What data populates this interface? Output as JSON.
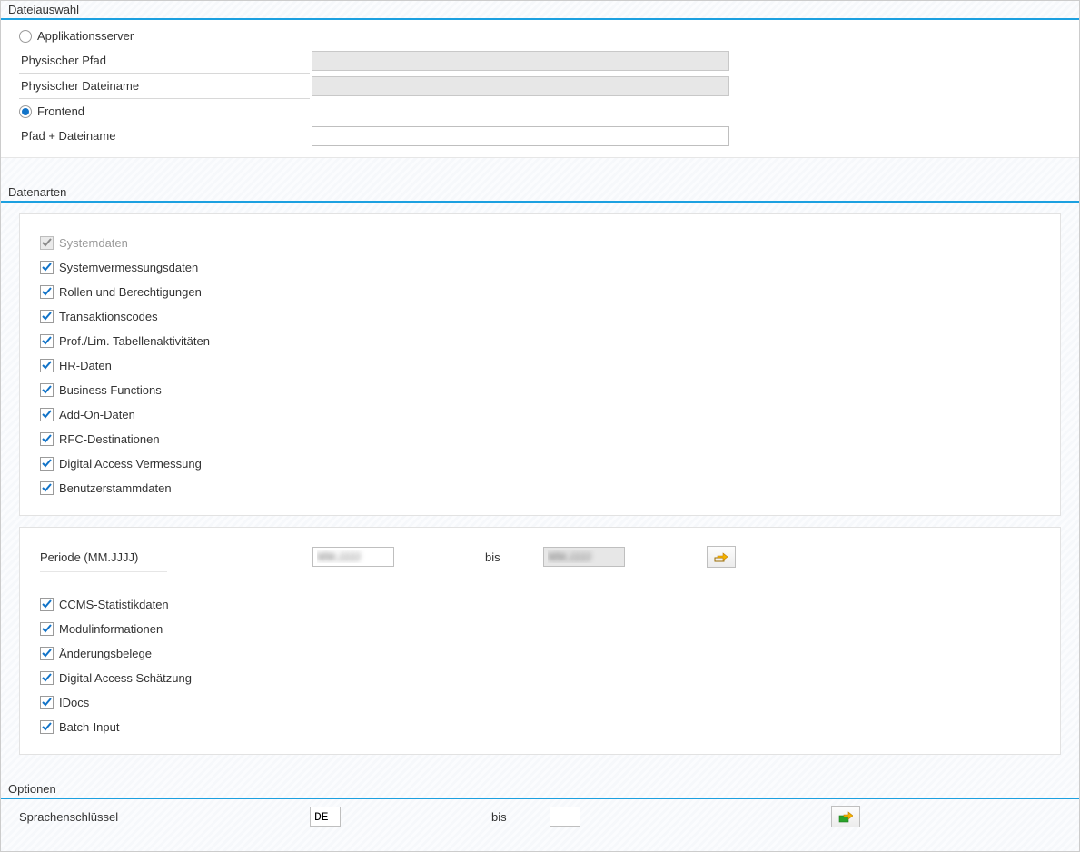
{
  "file_selection": {
    "title": "Dateiauswahl",
    "source_app_server": {
      "label": "Applikationsserver",
      "checked": false
    },
    "phys_path_label": "Physischer Pfad",
    "phys_path_value": "",
    "phys_file_label": "Physischer Dateiname",
    "phys_file_value": "",
    "source_frontend": {
      "label": "Frontend",
      "checked": true
    },
    "frontend_path_label": "Pfad + Dateiname",
    "frontend_path_value": ""
  },
  "data_types": {
    "title": "Datenarten",
    "group1": [
      {
        "key": "systemdaten",
        "label": "Systemdaten",
        "checked": true,
        "disabled": true
      },
      {
        "key": "sysvermessung",
        "label": "Systemvermessungsdaten",
        "checked": true,
        "disabled": false
      },
      {
        "key": "rollen",
        "label": "Rollen und Berechtigungen",
        "checked": true,
        "disabled": false
      },
      {
        "key": "tcodes",
        "label": "Transaktionscodes",
        "checked": true,
        "disabled": false
      },
      {
        "key": "proflim",
        "label": "Prof./Lim. Tabellenaktivitäten",
        "checked": true,
        "disabled": false
      },
      {
        "key": "hrdaten",
        "label": "HR-Daten",
        "checked": true,
        "disabled": false
      },
      {
        "key": "businessfunc",
        "label": "Business Functions",
        "checked": true,
        "disabled": false
      },
      {
        "key": "addon",
        "label": "Add-On-Daten",
        "checked": true,
        "disabled": false
      },
      {
        "key": "rfcdest",
        "label": "RFC-Destinationen",
        "checked": true,
        "disabled": false
      },
      {
        "key": "digitalaccess_ver",
        "label": "Digital Access Vermessung",
        "checked": true,
        "disabled": false
      },
      {
        "key": "benutzerstamm",
        "label": "Benutzerstammdaten",
        "checked": true,
        "disabled": false
      }
    ],
    "periode": {
      "label": "Periode (MM.JJJJ)",
      "from": "MM.JJJJ",
      "bis_label": "bis",
      "to": "MM.JJJJ"
    },
    "group2": [
      {
        "key": "ccms",
        "label": "CCMS-Statistikdaten",
        "checked": true
      },
      {
        "key": "modulinfo",
        "label": "Modulinformationen",
        "checked": true
      },
      {
        "key": "aenderung",
        "label": "Änderungsbelege",
        "checked": true
      },
      {
        "key": "digacc_est",
        "label": "Digital Access Schätzung",
        "checked": true
      },
      {
        "key": "idocs",
        "label": "IDocs",
        "checked": true
      },
      {
        "key": "batchinput",
        "label": "Batch-Input",
        "checked": true
      }
    ]
  },
  "options": {
    "title": "Optionen",
    "lang_key_label": "Sprachenschlüssel",
    "lang_key_value": "DE",
    "bis_label": "bis",
    "lang_key_to": ""
  }
}
